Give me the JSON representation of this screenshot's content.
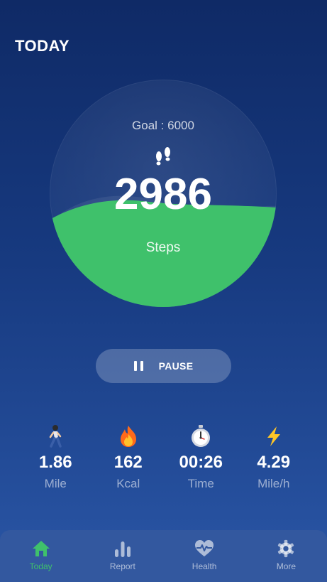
{
  "header": {
    "title": "TODAY"
  },
  "progress": {
    "goal_text": "Goal : 6000",
    "steps": "2986",
    "steps_label": "Steps",
    "fraction": 0.498
  },
  "controls": {
    "pause_label": "PAUSE"
  },
  "stats": [
    {
      "icon": "walking-person-icon",
      "value": "1.86",
      "unit": "Mile"
    },
    {
      "icon": "flame-icon",
      "value": "162",
      "unit": "Kcal"
    },
    {
      "icon": "stopwatch-icon",
      "value": "00:26",
      "unit": "Time"
    },
    {
      "icon": "lightning-icon",
      "value": "4.29",
      "unit": "Mile/h"
    }
  ],
  "nav": [
    {
      "icon": "home-icon",
      "label": "Today",
      "active": true
    },
    {
      "icon": "bar-chart-icon",
      "label": "Report",
      "active": false
    },
    {
      "icon": "heart-pulse-icon",
      "label": "Health",
      "active": false
    },
    {
      "icon": "gear-icon",
      "label": "More",
      "active": false
    }
  ],
  "colors": {
    "accent_green": "#3fc16b",
    "background_top": "#0f2a66",
    "background_bottom": "#2a56a6",
    "nav_background": "#33589f"
  }
}
